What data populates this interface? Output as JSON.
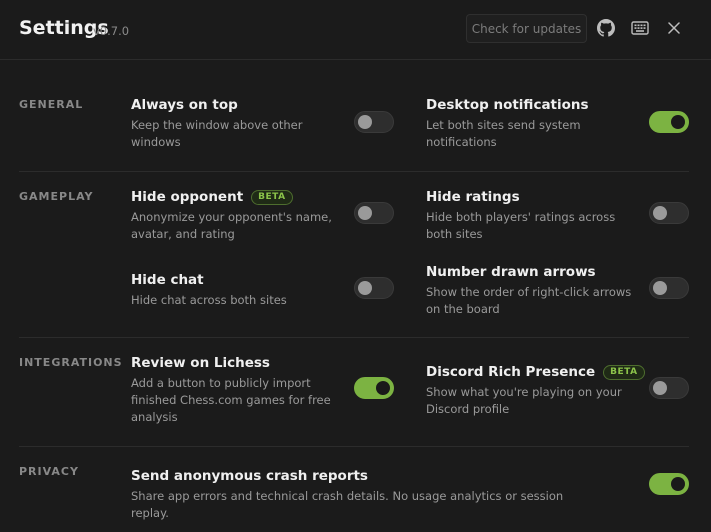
{
  "header": {
    "title": "Settings",
    "version": "v0.7.0",
    "update_button": "Check for updates",
    "icons": [
      "github-icon",
      "keyboard-icon",
      "close-icon"
    ]
  },
  "colors": {
    "accent": "#7cb342",
    "background": "#1b1b1b"
  },
  "sections": {
    "general": {
      "label": "GENERAL",
      "always_on_top": {
        "title": "Always on top",
        "desc": "Keep the window above other windows",
        "enabled": false
      },
      "desktop_notifications": {
        "title": "Desktop notifications",
        "desc": "Let both sites send system notifications",
        "enabled": true
      }
    },
    "gameplay": {
      "label": "GAMEPLAY",
      "hide_opponent": {
        "title": "Hide opponent",
        "badge": "BETA",
        "desc": "Anonymize your opponent's name, avatar, and rating",
        "enabled": false
      },
      "hide_ratings": {
        "title": "Hide ratings",
        "desc": "Hide both players' ratings across both sites",
        "enabled": false
      },
      "hide_chat": {
        "title": "Hide chat",
        "desc": "Hide chat across both sites",
        "enabled": false
      },
      "number_arrows": {
        "title": "Number drawn arrows",
        "desc": "Show the order of right-click arrows on the board",
        "enabled": false
      }
    },
    "integrations": {
      "label": "INTEGRATIONS",
      "review_lichess": {
        "title": "Review on Lichess",
        "desc": "Add a button to publicly import finished Chess.com games for free analysis",
        "enabled": true
      },
      "discord": {
        "title": "Discord Rich Presence",
        "badge": "BETA",
        "desc": "Show what you're playing on your Discord profile",
        "enabled": false
      }
    },
    "privacy": {
      "label": "PRIVACY",
      "crash_reports": {
        "title": "Send anonymous crash reports",
        "desc": "Share app errors and technical crash details. No usage analytics or session replay.",
        "enabled": true
      }
    }
  }
}
